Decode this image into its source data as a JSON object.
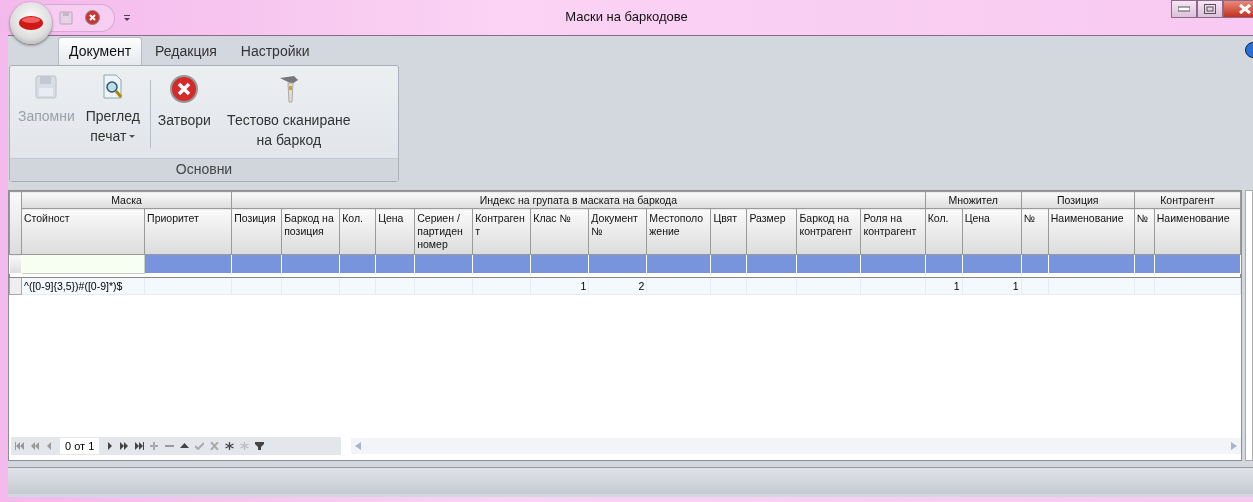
{
  "window": {
    "title": "Маски на баркодове"
  },
  "tabs": [
    {
      "label": "Документ",
      "selected": true
    },
    {
      "label": "Редакция",
      "selected": false
    },
    {
      "label": "Настройки",
      "selected": false
    }
  ],
  "ribbon": {
    "group_label": "Основни",
    "buttons": [
      {
        "kind": "save",
        "label": "Запомни",
        "disabled": true,
        "dropdown": false
      },
      {
        "kind": "preview",
        "label": "Преглед печат",
        "disabled": false,
        "dropdown": true
      },
      {
        "kind": "close",
        "label": "Затвори",
        "disabled": false,
        "dropdown": false
      },
      {
        "kind": "scanner",
        "label": "Тестово сканиране на баркод",
        "disabled": false,
        "dropdown": false
      }
    ]
  },
  "table": {
    "column_groups": [
      {
        "label": "Маска"
      },
      {
        "label": "Индекс на групата в маската на баркода"
      },
      {
        "label": "Множител"
      },
      {
        "label": "Позиция"
      },
      {
        "label": "Контрагент"
      }
    ],
    "columns": [
      "Стойност",
      "Приоритет",
      "Позиция",
      "Баркод на позиция",
      "Кол.",
      "Цена",
      "Сериен / партиден номер",
      "Контрагент",
      "Клас №",
      "Документ №",
      "Местоположение",
      "Цвят",
      "Размер",
      "Баркод на контрагент",
      "Роля на контрагент",
      "Кол.",
      "Цена",
      "№",
      "Наименование",
      "№",
      "Наименование"
    ],
    "rows": [
      {
        "column_1": "^([0-9]{3,5})#([0-9]*)$",
        "column_9": "1",
        "column_10": "2",
        "column_16": "1",
        "column_17": "1"
      }
    ]
  },
  "navigator": {
    "position": "0 от 1"
  }
}
